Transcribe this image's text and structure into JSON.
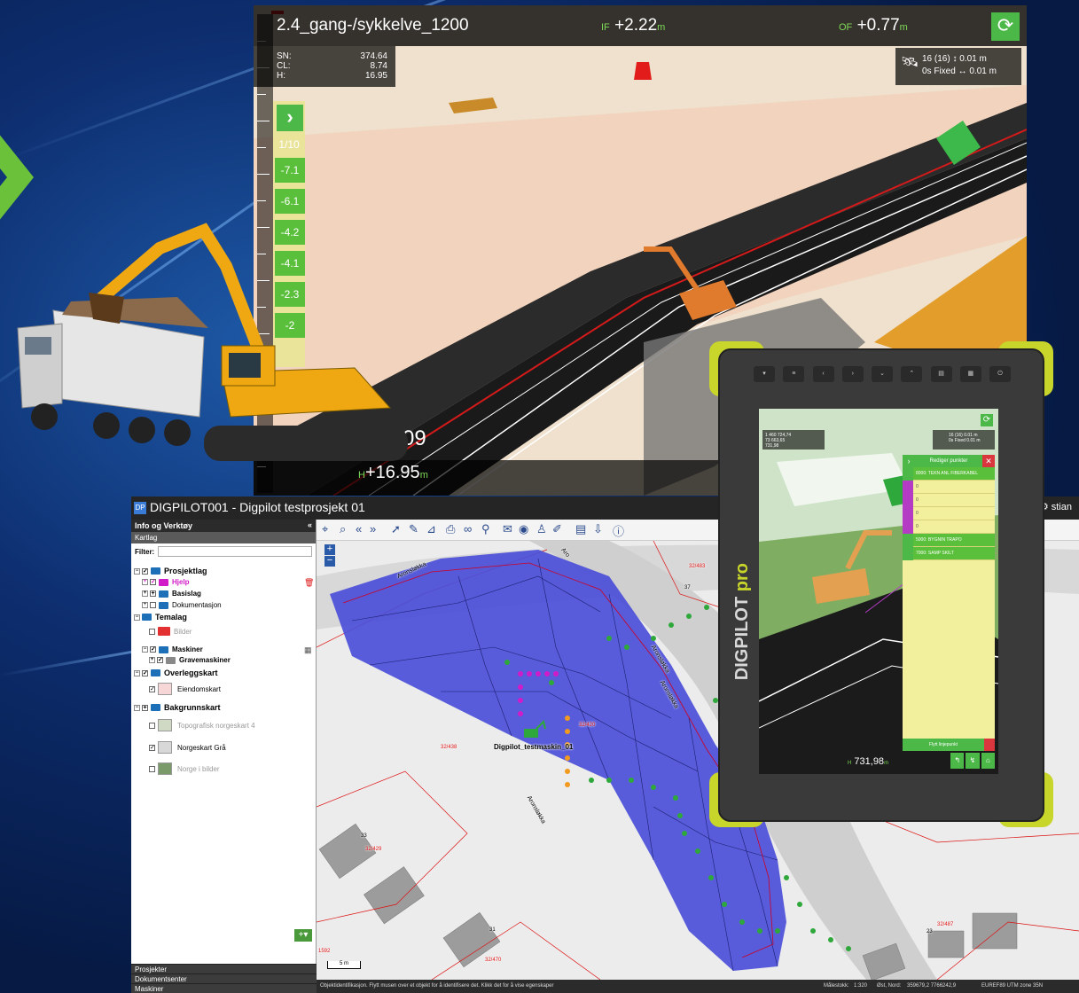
{
  "top_view": {
    "profile_name": "2.4_gang-/sykkelve_1200",
    "if_prefix": "IF",
    "if_value": "+2.22",
    "of_prefix": "OF",
    "of_value": "+0.77",
    "unit": "m",
    "refresh_icon": "refresh-icon",
    "info": {
      "sn_label": "SN:",
      "sn_value": "374.64",
      "cl_label": "CL:",
      "cl_value": "8.74",
      "h_label": "H:",
      "h_value": "16.95"
    },
    "gps": {
      "satellites": "16 (16)",
      "fix": "0s Fixed",
      "vertical_acc": "0.01 m",
      "horizontal_acc": "0.01 m"
    },
    "next_label": "›",
    "page": "1/10",
    "steps": [
      "-7.1",
      "-6.1",
      "-4.2",
      "-4.1",
      "-2.3",
      "-2"
    ],
    "depth": "-3.09",
    "height_prefix": "H",
    "height_value": "+16.95"
  },
  "web_app": {
    "title": "DIGPILOT001 - Digpilot testprosjekt 01",
    "user": "stian",
    "sidebar_title": "Info og Verktøy",
    "sidebar_tab": "Kartlag",
    "filter_label": "Filter:",
    "tree": {
      "prosjektlag": "Prosjektlag",
      "hjelp": "Hjelp",
      "basislag": "Basislag",
      "dokumentasjon": "Dokumentasjon",
      "temalag": "Temalag",
      "bilder": "Bilder",
      "maskiner": "Maskiner",
      "gravemaskiner": "Gravemaskiner",
      "overleggskart": "Overleggskart",
      "eiendomskart": "Eiendomskart",
      "bakgrunnskart": "Bakgrunnskart",
      "topografisk": "Topografisk norgeskart 4",
      "norgeskart_gra": "Norgeskart Grå",
      "norge_bilder": "Norge i bilder"
    },
    "footer_links": [
      "Prosjekter",
      "Dokumentsenter",
      "Maskiner"
    ],
    "map": {
      "machine_label": "Digpilot_testmaskin_01",
      "street_1": "Aronsløkka",
      "street_2": "Aronsløkka",
      "street_3": "Aronsløkka",
      "street_4": "Aronsløkka",
      "street_5": "Aro",
      "parcels": [
        "32/483",
        "32/429",
        "32/438",
        "32/487",
        "32/470",
        "1592",
        "32/420"
      ],
      "house_numbers": [
        "37",
        "33",
        "31",
        "23"
      ],
      "scale_label": "5 m"
    },
    "status": {
      "hint": "Objektidentifikasjon. Flytt musen over et objekt for å identifisere det. Klikk det for å vise egenskaper",
      "scale_label": "Målestokk:",
      "scale_value": "1:320",
      "coords_label": "Øst, Nord:",
      "coords_value": "359679,2 7766242,9",
      "crs": "EUREF89 UTM zone 35N"
    }
  },
  "tablet": {
    "brand_prefix": "DIGPILOT",
    "brand_suffix": "pro",
    "info_line1": "1 460 724,74",
    "info_line2": "73 663,65",
    "info_line3": "731,98",
    "gps_line1": "16 (16)  0.01 m",
    "gps_line2": "0s Fixed  0.01 m",
    "panel_title": "Rediger punkter",
    "rows": [
      "8000: TEKN ANL FIBERKABEL",
      "0",
      "0",
      "0",
      "0",
      "5000: BYGNIN TRAPO",
      "7000: SAMP SKILT"
    ],
    "footer_title": "Flytt linjepunkt",
    "height_prefix": "H",
    "height_value": "731,98",
    "height_unit": "m"
  },
  "colors": {
    "accent_green": "#4cb848",
    "delete_red": "#d9363e",
    "lime_bumper": "#c8d52b",
    "map_polygon": "#4b4fd8"
  }
}
